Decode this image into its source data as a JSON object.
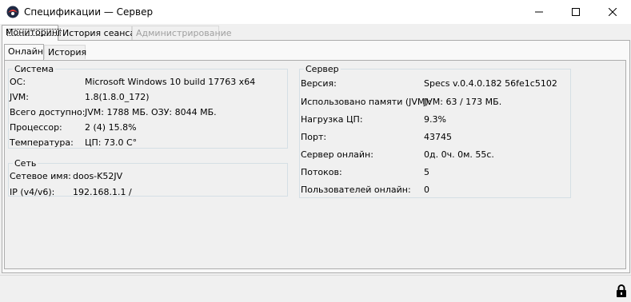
{
  "window": {
    "title": "Спецификации — Сервер"
  },
  "main_tabs": [
    {
      "label": "Мониторинг",
      "state": "active"
    },
    {
      "label": "История сеанса",
      "state": "normal"
    },
    {
      "label": "Администрирование",
      "state": "disabled"
    }
  ],
  "sub_tabs": [
    {
      "label": "Онлайн",
      "state": "active"
    },
    {
      "label": "История",
      "state": "normal"
    }
  ],
  "system": {
    "legend": "Система",
    "rows": [
      {
        "label": "ОС:",
        "value": "Microsoft Windows 10 build 17763 x64"
      },
      {
        "label": "JVM:",
        "value": "1.8(1.8.0_172)"
      },
      {
        "label": "Всего доступно:",
        "value": "JVM: 1788 МБ. ОЗУ: 8044 МБ."
      },
      {
        "label": "Процессор:",
        "value": "2 (4) 15.8%"
      },
      {
        "label": "Температура:",
        "value": "ЦП: 73.0 C°"
      }
    ]
  },
  "network": {
    "legend": "Сеть",
    "rows": [
      {
        "label": "Сетевое имя:",
        "value": "doos-K52JV"
      },
      {
        "label": "IP (v4/v6):",
        "value": "192.168.1.1 /"
      }
    ]
  },
  "server": {
    "legend": "Сервер",
    "rows": [
      {
        "label": "Версия:",
        "value": "Specs v.0.4.0.182 56fe1c5102"
      },
      {
        "label": "Использовано памяти (JVM):",
        "value": "JVM: 63 / 173 МБ."
      },
      {
        "label": "Нагрузка ЦП:",
        "value": "9.3%"
      },
      {
        "label": "Порт:",
        "value": "43745"
      },
      {
        "label": "Сервер онлайн:",
        "value": "0д. 0ч. 0м. 55с."
      },
      {
        "label": "Потоков:",
        "value": "5"
      },
      {
        "label": "Пользователей онлайн:",
        "value": "0"
      }
    ]
  },
  "status": {
    "lock_icon": "lock-icon"
  }
}
